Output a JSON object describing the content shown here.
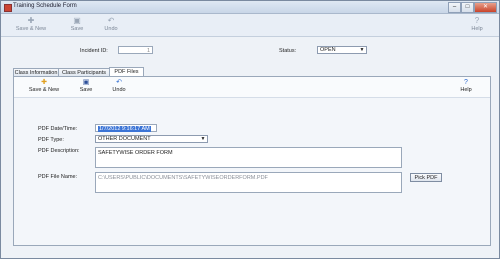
{
  "window": {
    "title": "Training Schedule Form"
  },
  "toolbar": {
    "save_new": "Save & New",
    "save": "Save",
    "undo": "Undo",
    "help": "Help"
  },
  "form": {
    "incident_label": "Incident ID:",
    "incident_value": "1",
    "status_label": "Status:",
    "status_value": "OPEN"
  },
  "tabs": [
    "Class Information",
    "Class Participants",
    "PDF Files"
  ],
  "panel_toolbar": {
    "save_new": "Save & New",
    "save": "Save",
    "undo": "Undo",
    "help": "Help"
  },
  "pdf": {
    "date_label": "PDF Date/Time:",
    "date_value": "1/7/2012 9:16:17 AM",
    "type_label": "PDF Type:",
    "type_value": "OTHER DOCUMENT",
    "desc_label": "PDF Description:",
    "desc_value": "SAFETYWISE ORDER FORM",
    "file_label": "PDF File Name:",
    "file_value": "C:\\USERS\\PUBLIC\\DOCUMENTS\\SAFETYWISEORDERFORM.PDF",
    "pick_button": "Pick PDF"
  },
  "colors": {
    "accent": "#3b74d6",
    "window_bg": "#eef2f7"
  }
}
